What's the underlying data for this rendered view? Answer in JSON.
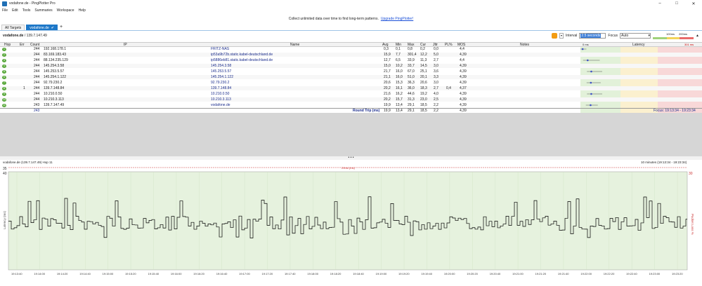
{
  "window": {
    "title": "vodafone.de - PingPlotter Pro",
    "controls": [
      "–",
      "□",
      "✕"
    ]
  },
  "menu": [
    "File",
    "Edit",
    "Tools",
    "Summaries",
    "Workspace",
    "Help"
  ],
  "banner": {
    "text": "Collect unlimited data over time to find long-term patterns.",
    "link": "Upgrade PingPlotter!"
  },
  "tabs": {
    "all_targets": "All Targets",
    "active": "vodafone.de",
    "add": "+"
  },
  "toolbar": {
    "target_name": "vodafone.de",
    "target_ip": " / 139.7.147.49",
    "interval_label": "Interval",
    "interval_value": "2.5 seconds",
    "focus_label": "Focus",
    "focus_value": "Auto",
    "legend_100": "100ms",
    "legend_200": "200ms"
  },
  "table": {
    "columns": [
      "Hop",
      "Err",
      "Count",
      "IP",
      "Name",
      "Avg",
      "Min",
      "Max",
      "Cur",
      "Jttr",
      "PL%",
      "MOS",
      "Notes",
      "Latency"
    ],
    "latency_scale_left": "0 ms",
    "latency_scale_right": "301 ms",
    "rows": [
      {
        "hop": "1",
        "err": "",
        "count": "244",
        "ip": "192.168.178.1",
        "name": "FRITZ-NAS",
        "avg": "0,3",
        "min": "0,1",
        "max": "0,8",
        "cur": "0,2",
        "jttr": "0,0",
        "pl": "",
        "mos": "4,4"
      },
      {
        "hop": "2",
        "err": "",
        "count": "244",
        "ip": "83.169.183.43",
        "name": "ip53a9b72b.static.kabel-deutschland.de",
        "avg": "15,9",
        "min": "7,7",
        "max": "301,4",
        "cur": "12,2",
        "jttr": "5,0",
        "pl": "",
        "mos": "4,39"
      },
      {
        "hop": "3",
        "err": "",
        "count": "244",
        "ip": "88.134.235.129",
        "name": "ip5886eb81.static.kabel-deutschland.de",
        "avg": "12,7",
        "min": "6,5",
        "max": "33,9",
        "cur": "11,3",
        "jttr": "2,7",
        "pl": "",
        "mos": "4,4"
      },
      {
        "hop": "4",
        "err": "",
        "count": "244",
        "ip": "145.254.3.58",
        "name": "145.254.3.58",
        "avg": "15,0",
        "min": "10,2",
        "max": "33,7",
        "cur": "14,5",
        "jttr": "3,0",
        "pl": "",
        "mos": "4,39"
      },
      {
        "hop": "5",
        "err": "",
        "count": "244",
        "ip": "145.253.5.57",
        "name": "145.253.5.57",
        "avg": "21,7",
        "min": "16,0",
        "max": "67,0",
        "cur": "25,1",
        "jttr": "3,6",
        "pl": "",
        "mos": "4,39"
      },
      {
        "hop": "6",
        "err": "",
        "count": "244",
        "ip": "145.254.1.122",
        "name": "145.254.1.122",
        "avg": "21,1",
        "min": "16,0",
        "max": "51,0",
        "cur": "20,1",
        "jttr": "3,3",
        "pl": "",
        "mos": "4,39"
      },
      {
        "hop": "7",
        "err": "",
        "count": "244",
        "ip": "92.79.230.2",
        "name": "92.79.230.2",
        "avg": "20,6",
        "min": "15,3",
        "max": "36,3",
        "cur": "20,6",
        "jttr": "3,0",
        "pl": "",
        "mos": "4,39"
      },
      {
        "hop": "8",
        "err": "1",
        "count": "244",
        "ip": "139.7.148.84",
        "name": "139.7.148.84",
        "avg": "20,2",
        "min": "16,1",
        "max": "36,0",
        "cur": "18,3",
        "jttr": "2,7",
        "pl": "0,4",
        "mos": "4,37"
      },
      {
        "hop": "9",
        "err": "",
        "count": "244",
        "ip": "10.210.0.50",
        "name": "10.210.0.50",
        "avg": "21,6",
        "min": "16,2",
        "max": "44,6",
        "cur": "19,2",
        "jttr": "4,0",
        "pl": "",
        "mos": "4,39"
      },
      {
        "hop": "10",
        "err": "",
        "count": "244",
        "ip": "10.210.3.113",
        "name": "10.210.3.113",
        "avg": "20,2",
        "min": "15,7",
        "max": "31,3",
        "cur": "23,0",
        "jttr": "2,5",
        "pl": "",
        "mos": "4,39"
      },
      {
        "hop": "11",
        "err": "",
        "count": "243",
        "ip": "139.7.147.49",
        "name": "vodafone.de",
        "avg": "19,9",
        "min": "13,4",
        "max": "29,1",
        "cur": "18,5",
        "jttr": "2,2",
        "pl": "",
        "mos": "4,39"
      }
    ],
    "summary": {
      "count": "243",
      "label": "Round Trip (ms)",
      "avg": "19,9",
      "min": "13,4",
      "max": "29,1",
      "cur": "18,5",
      "jttr": "2,2",
      "mos": "4,39",
      "focus": "Focus: 19:13:34 - 19:23:34"
    }
  },
  "splitter": "• • •",
  "graph": {
    "title": "vodafone.de (139.7.147.49) Hop 11",
    "range": "10 minutes (19:13:34 - 19:23:34)",
    "top_label": "35",
    "top_marker": "29ms (ms)",
    "y_label_left": "Latency (ms)",
    "y_label_right": "Packet Loss %",
    "y_top": "40",
    "y_top_right": "30",
    "x_ticks": [
      "19:13:40",
      "19:14:00",
      "19:14:20",
      "19:14:40",
      "19:15:00",
      "19:15:20",
      "19:15:40",
      "19:16:00",
      "19:16:20",
      "19:16:40",
      "19:17:00",
      "19:17:20",
      "19:17:40",
      "19:18:00",
      "19:18:20",
      "19:18:40",
      "19:19:00",
      "19:19:20",
      "19:19:40",
      "19:20:00",
      "19:20:20",
      "19:20:40",
      "19:21:00",
      "19:21:20",
      "19:21:40",
      "19:22:00",
      "19:22:20",
      "19:22:40",
      "19:23:00",
      "19:23:20"
    ],
    "ylim": [
      0,
      40
    ],
    "colors": {
      "bg_good": "#e6f2de",
      "line": "#000000",
      "grid": "#bcd8b0"
    }
  }
}
